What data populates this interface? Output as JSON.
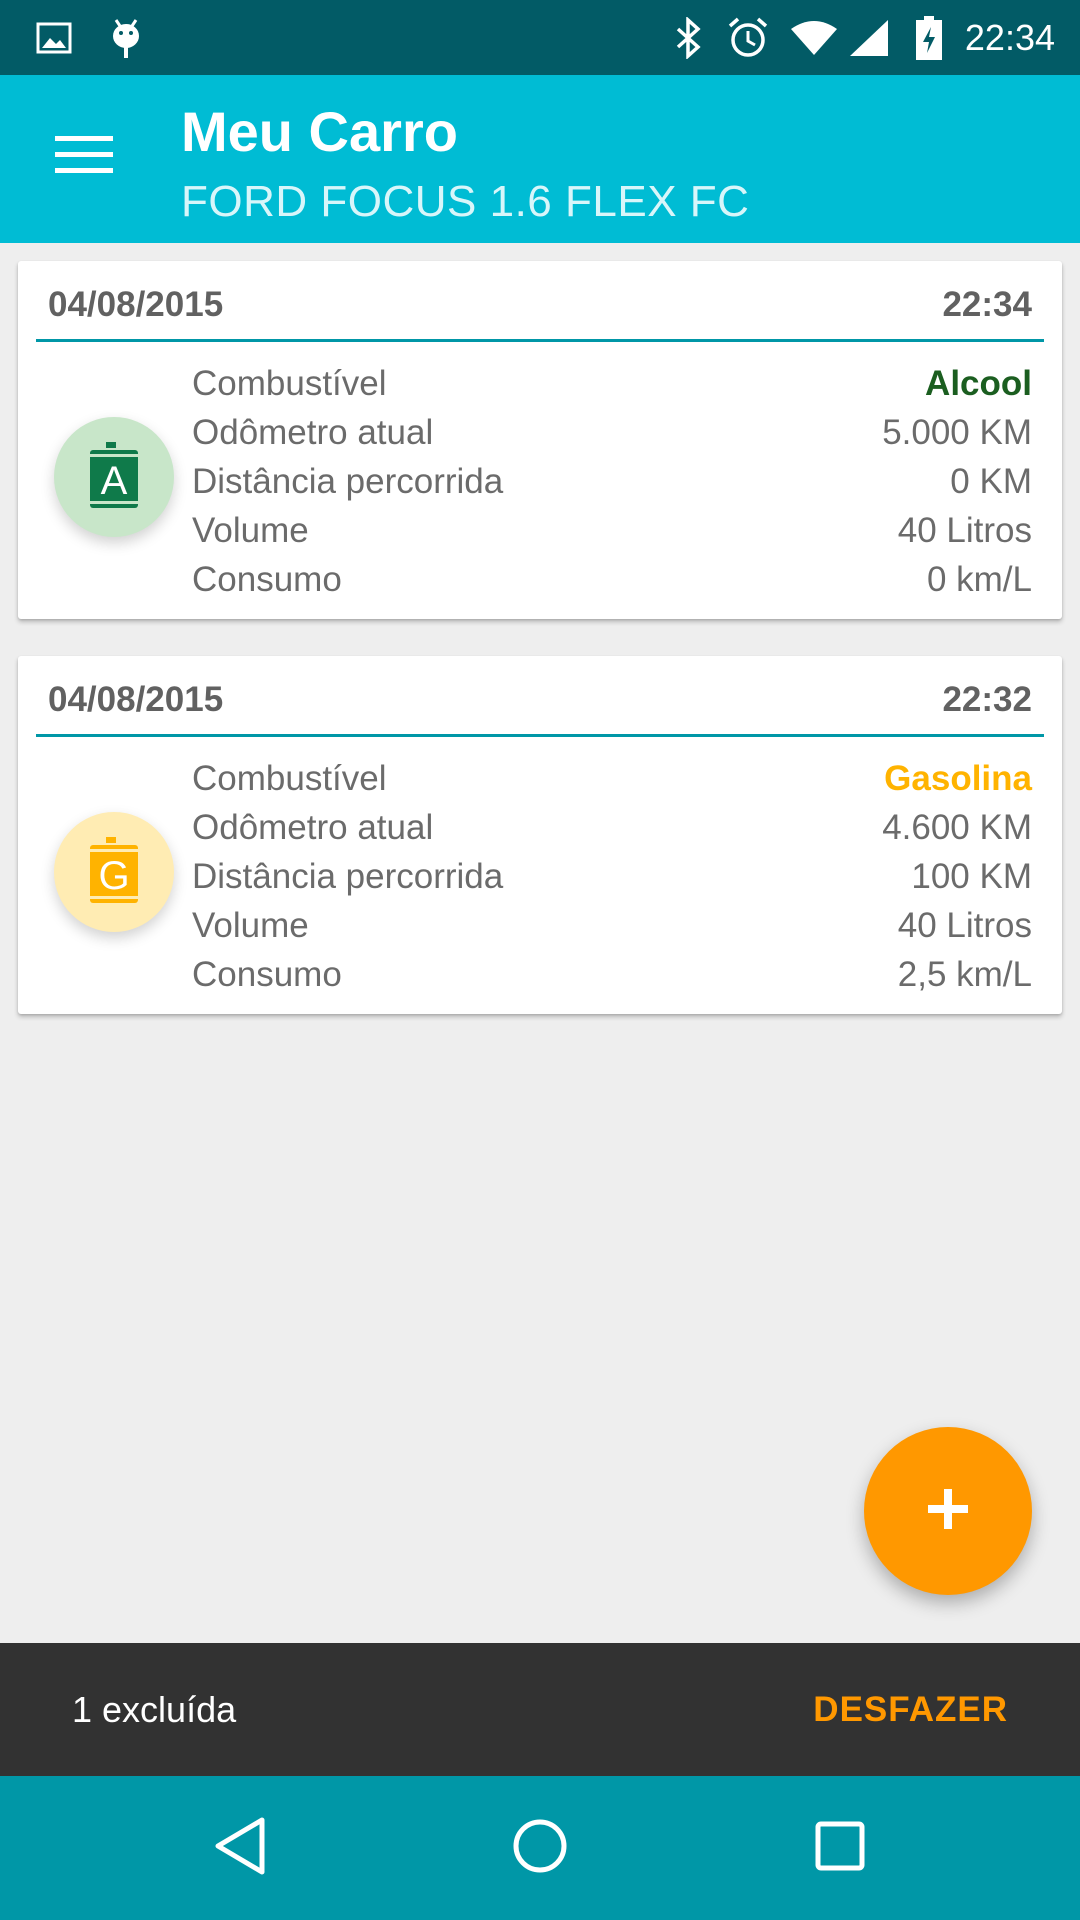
{
  "status_bar": {
    "time": "22:34",
    "icons": [
      "image-icon",
      "android-debug-icon",
      "bluetooth-icon",
      "alarm-icon",
      "wifi-icon",
      "cell-signal-icon",
      "battery-charging-icon"
    ]
  },
  "app_bar": {
    "title": "Meu Carro",
    "subtitle": "FORD FOCUS 1.6 FLEX FC",
    "menu_icon": "hamburger-menu-icon"
  },
  "labels": {
    "fuel": "Combustível",
    "odometer": "Odômetro atual",
    "distance": "Distância percorrida",
    "volume": "Volume",
    "consumption": "Consumo"
  },
  "entries": [
    {
      "date": "04/08/2015",
      "time": "22:34",
      "badge_letter": "A",
      "fuel": "Alcool",
      "odometer": "5.000 KM",
      "distance": "0 KM",
      "volume": "40 Litros",
      "consumption": "0 km/L",
      "fuel_color": "#1b5e20",
      "badge_bg": "#c8e6c9",
      "badge_fg": "#0f7a4a"
    },
    {
      "date": "04/08/2015",
      "time": "22:32",
      "badge_letter": "G",
      "fuel": "Gasolina",
      "odometer": "4.600 KM",
      "distance": "100 KM",
      "volume": "40 Litros",
      "consumption": "2,5 km/L",
      "fuel_color": "#ffb300",
      "badge_bg": "#ffecb3",
      "badge_fg": "#ffb300"
    }
  ],
  "fab": {
    "icon": "plus-icon",
    "color": "#ff9800"
  },
  "snackbar": {
    "text": "1 excluída",
    "action": "DESFAZER"
  },
  "nav_bar": {
    "icons": [
      "back-icon",
      "home-icon",
      "recents-icon"
    ]
  },
  "colors": {
    "status_bar": "#025b66",
    "app_bar": "#00bcd4",
    "nav_bar": "#0097a7",
    "accent": "#ff9800"
  }
}
